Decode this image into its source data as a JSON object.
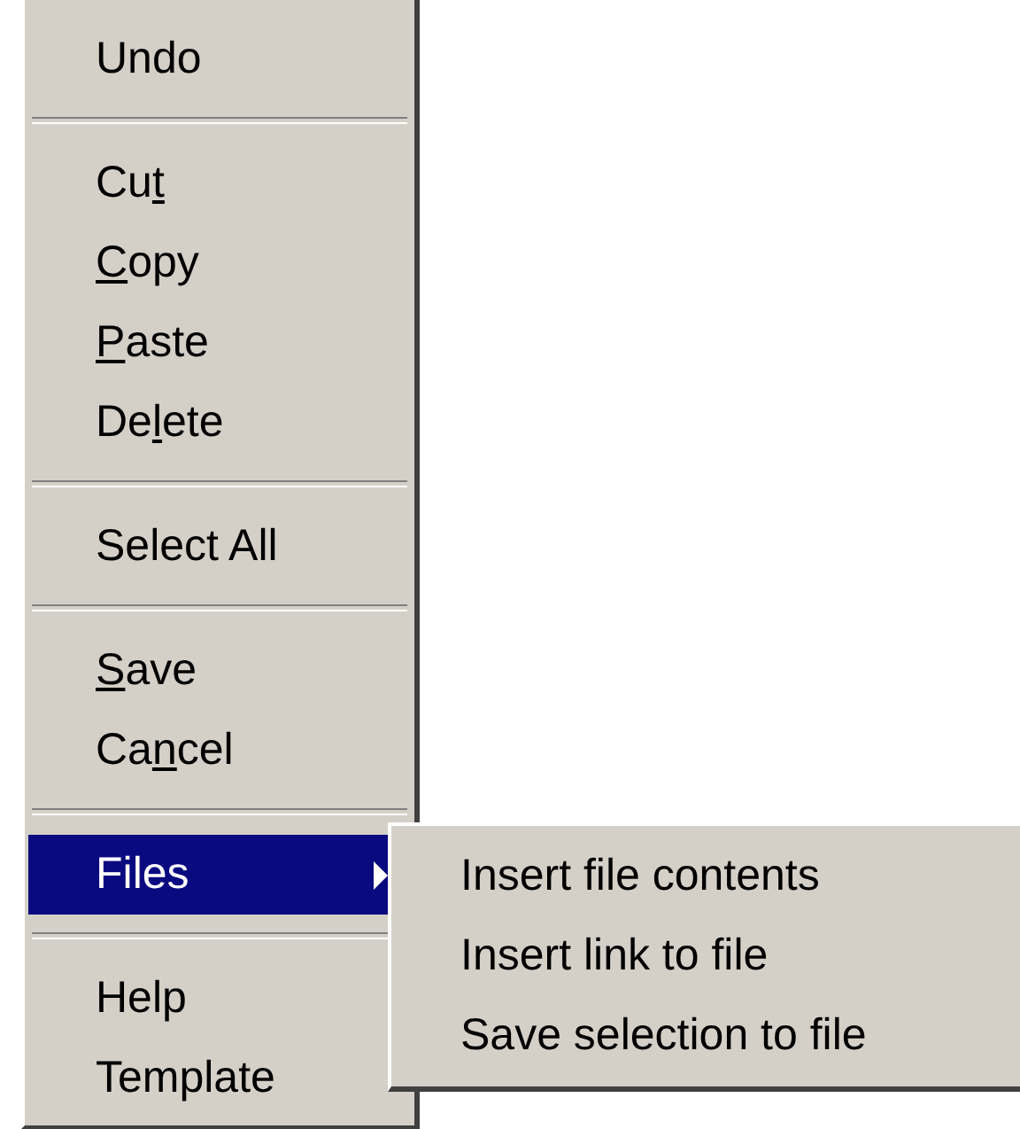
{
  "menu": {
    "items": [
      {
        "kind": "item",
        "label": [
          {
            "text": "Undo",
            "underlined": false
          }
        ],
        "selected": false
      },
      {
        "kind": "separator"
      },
      {
        "kind": "item",
        "label": [
          {
            "text": "Cu",
            "underlined": false
          },
          {
            "text": "t",
            "underlined": true
          }
        ],
        "selected": false
      },
      {
        "kind": "item",
        "label": [
          {
            "text": "C",
            "underlined": true
          },
          {
            "text": "opy",
            "underlined": false
          }
        ],
        "selected": false
      },
      {
        "kind": "item",
        "label": [
          {
            "text": "P",
            "underlined": true
          },
          {
            "text": "aste",
            "underlined": false
          }
        ],
        "selected": false
      },
      {
        "kind": "item",
        "label": [
          {
            "text": "De",
            "underlined": false
          },
          {
            "text": "l",
            "underlined": true
          },
          {
            "text": "ete",
            "underlined": false
          }
        ],
        "selected": false
      },
      {
        "kind": "separator"
      },
      {
        "kind": "item",
        "label": [
          {
            "text": "Select All",
            "underlined": false
          }
        ],
        "selected": false
      },
      {
        "kind": "separator"
      },
      {
        "kind": "item",
        "label": [
          {
            "text": "S",
            "underlined": true
          },
          {
            "text": "ave",
            "underlined": false
          }
        ],
        "selected": false
      },
      {
        "kind": "item",
        "label": [
          {
            "text": "Ca",
            "underlined": false
          },
          {
            "text": "n",
            "underlined": true
          },
          {
            "text": "cel",
            "underlined": false
          }
        ],
        "selected": false
      },
      {
        "kind": "separator"
      },
      {
        "kind": "item",
        "label": [
          {
            "text": "Files",
            "underlined": false
          }
        ],
        "selected": true,
        "has_submenu": true
      },
      {
        "kind": "separator"
      },
      {
        "kind": "item",
        "label": [
          {
            "text": "Help",
            "underlined": false
          }
        ],
        "selected": false
      },
      {
        "kind": "item",
        "label": [
          {
            "text": "Template",
            "underlined": false
          }
        ],
        "selected": false
      }
    ]
  },
  "submenu": {
    "items": [
      {
        "label": "Insert file contents",
        "selected": false
      },
      {
        "label": "Insert link to file",
        "selected": false
      },
      {
        "label": "Save selection to file",
        "selected": false
      }
    ]
  }
}
